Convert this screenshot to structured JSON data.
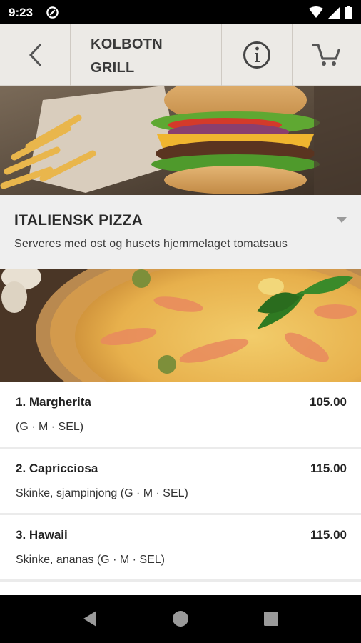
{
  "status_bar": {
    "time": "9:23",
    "left_icon": "data-saver-icon",
    "right_icons": [
      "wifi-icon",
      "cellular-signal-icon",
      "battery-icon"
    ]
  },
  "header": {
    "back_icon": "chevron-left-icon",
    "title": "KOLBOTN GRILL",
    "info_icon": "info-icon",
    "cart_icon": "cart-icon"
  },
  "category": {
    "title": "ITALIENSK PIZZA",
    "description": "Serveres med ost og husets hjemmelaget tomatsaus",
    "toggle_icon": "caret-down-icon"
  },
  "menu_items": [
    {
      "name": "1. Margherita",
      "price": "105.00",
      "description": "(G · M · SEL)"
    },
    {
      "name": "2. Capricciosa",
      "price": "115.00",
      "description": "Skinke, sjampinjong (G · M · SEL)"
    },
    {
      "name": "3. Hawaii",
      "price": "115.00",
      "description": "Skinke, ananas (G · M · SEL)"
    }
  ],
  "nav_bar": {
    "back": "nav-back-icon",
    "home": "nav-home-icon",
    "recents": "nav-recents-icon"
  },
  "colors": {
    "header_bg": "#eceae6",
    "category_bg": "#efefef",
    "system_bar": "#000000",
    "text_dark": "#222222"
  }
}
